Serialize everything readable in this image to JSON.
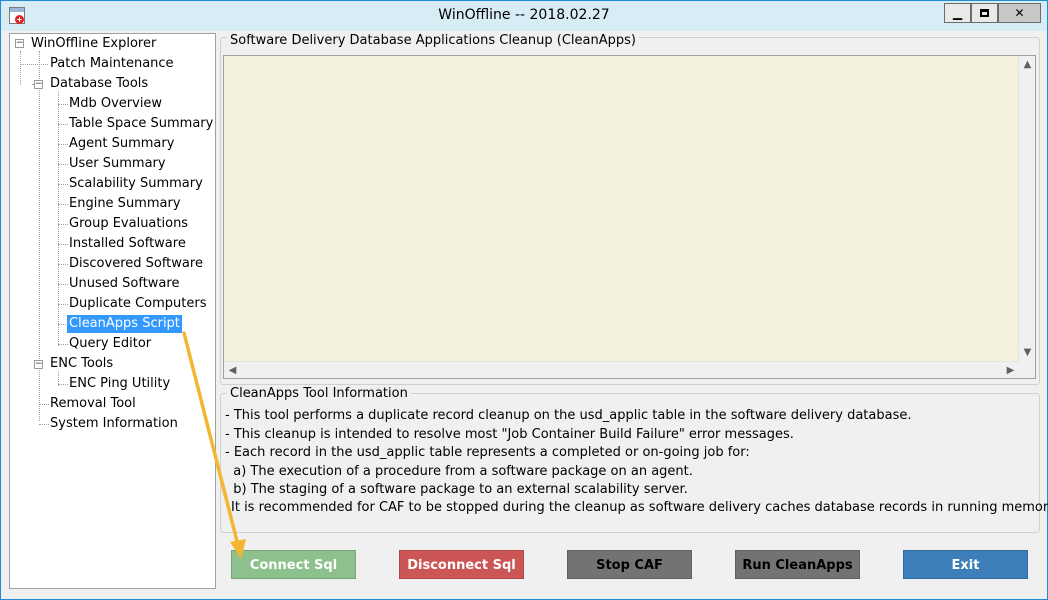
{
  "window": {
    "title": "WinOffline -- 2018.02.27",
    "controls": {
      "minimize": "▁",
      "close": "✕"
    }
  },
  "tree": {
    "root": "WinOffline Explorer",
    "patch_maintenance": "Patch Maintenance",
    "database_tools": "Database Tools",
    "db_items": [
      "Mdb Overview",
      "Table Space Summary",
      "Agent Summary",
      "User Summary",
      "Scalability Summary",
      "Engine Summary",
      "Group Evaluations",
      "Installed Software",
      "Discovered Software",
      "Unused Software",
      "Duplicate Computers",
      "CleanApps Script",
      "Query Editor"
    ],
    "selected_item": "CleanApps Script",
    "enc_tools": "ENC Tools",
    "enc_ping": "ENC Ping Utility",
    "removal_tool": "Removal Tool",
    "system_information": "System Information"
  },
  "output_group": {
    "label": "Software Delivery Database Applications Cleanup (CleanApps)",
    "content": ""
  },
  "info_group": {
    "label": "CleanApps Tool Information",
    "lines": [
      "- This tool performs a duplicate record cleanup on the usd_applic table in the software delivery database.",
      "- This cleanup is intended to resolve most \"Job Container Build Failure\" error messages.",
      "- Each record in the usd_applic table represents a completed or on-going job for:",
      "  a) The execution of a procedure from a software package on an agent.",
      "  b) The staging of a software package to an external scalability server.",
      "It is recommended for CAF to be stopped during the cleanup as software delivery caches database records in running memory."
    ]
  },
  "buttons": {
    "connect": "Connect Sql",
    "disconnect": "Disconnect Sql",
    "stop_caf": "Stop CAF",
    "run_cleanapps": "Run CleanApps",
    "exit": "Exit"
  },
  "colors": {
    "connect": "#8cc08c",
    "disconnect": "#cc5555",
    "stop_caf": "#737373",
    "run_cleanapps": "#737373",
    "exit": "#3d7fba",
    "selection": "#3399ff",
    "output_bg": "#f4f2dd",
    "annotation_arrow": "#f2b630"
  }
}
